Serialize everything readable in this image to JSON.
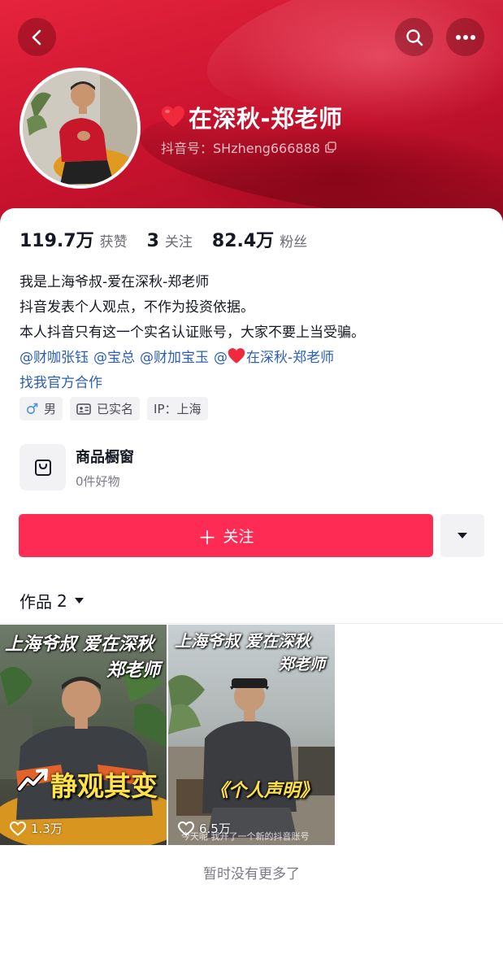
{
  "profile": {
    "nickname": "在深秋-郑老师",
    "douyin_id": "抖音号：SHzheng666888",
    "heart_color": "#f02a3c"
  },
  "stats": [
    {
      "value": "119.7万",
      "label": "获赞"
    },
    {
      "value": "3",
      "label": "关注"
    },
    {
      "value": "82.4万",
      "label": "粉丝"
    }
  ],
  "bio": {
    "lines": [
      "我是上海爷叔-爱在深秋-郑老师",
      "抖音发表个人观点，不作为投资依据。",
      "本人抖音只有这一个实名认证账号，大家不要上当受骗。"
    ],
    "mentions": [
      "@财咖张钰",
      "@宝总",
      "@财加宝玉",
      "@",
      "在深秋-郑老师"
    ],
    "business_link": "找我官方合作"
  },
  "tags": [
    {
      "icon": "male-icon",
      "label": "男"
    },
    {
      "icon": "id-card-icon",
      "label": "已实名"
    },
    {
      "icon": "",
      "label": "IP：上海"
    }
  ],
  "shop": {
    "title": "商品橱窗",
    "subtitle": "0件好物"
  },
  "actions": {
    "follow_label": "关注",
    "follow_color": "#fe2c55"
  },
  "works": {
    "tab_label": "作品",
    "count": "2",
    "videos": [
      {
        "title_line1": "上海爷叔 爱在深秋",
        "title_line2": "郑老师",
        "overlay_text": "静观其变",
        "likes": "1.3万"
      },
      {
        "title_line1": "上海爷叔 爱在深秋",
        "title_line2": "郑老师",
        "overlay_text": "《个人声明》",
        "caption": "今天呢 我开了一个新的抖音账号",
        "likes": "6.5万"
      }
    ]
  },
  "footer": {
    "end_text": "暂时没有更多了"
  },
  "colors": {
    "header_red": "#cc1430",
    "link_blue": "#2b5fb8",
    "overlay_yellow": "#ffe14a"
  }
}
